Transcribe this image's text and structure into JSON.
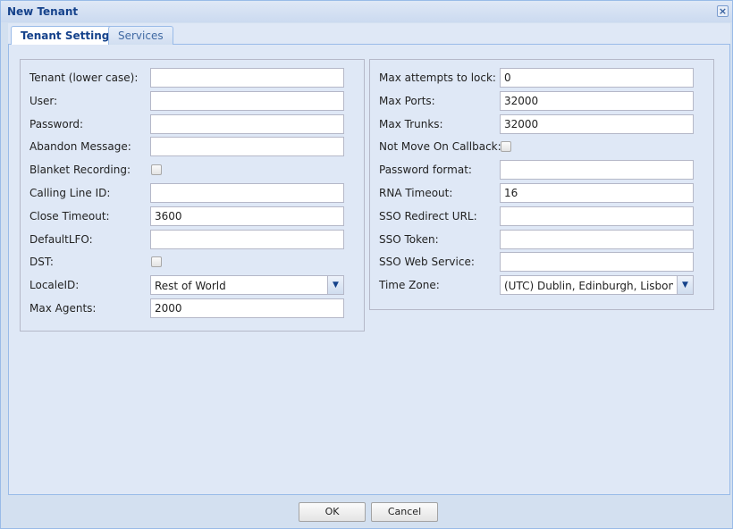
{
  "window": {
    "title": "New Tenant",
    "close_label": "×"
  },
  "tabs": [
    {
      "label": "Tenant Settings",
      "active": true
    },
    {
      "label": "Services",
      "active": false
    }
  ],
  "left_fields": [
    {
      "label": "Tenant (lower case):",
      "type": "text",
      "value": ""
    },
    {
      "label": "User:",
      "type": "text",
      "value": ""
    },
    {
      "label": "Password:",
      "type": "text",
      "value": ""
    },
    {
      "label": "Abandon Message:",
      "type": "text",
      "value": ""
    },
    {
      "label": "Blanket Recording:",
      "type": "checkbox",
      "checked": false
    },
    {
      "label": "Calling Line ID:",
      "type": "text",
      "value": ""
    },
    {
      "label": "Close Timeout:",
      "type": "text",
      "value": "3600"
    },
    {
      "label": "DefaultLFO:",
      "type": "text",
      "value": ""
    },
    {
      "label": "DST:",
      "type": "checkbox",
      "checked": false
    },
    {
      "label": "LocaleID:",
      "type": "combo",
      "value": "Rest of World"
    },
    {
      "label": "Max Agents:",
      "type": "text",
      "value": "2000"
    }
  ],
  "right_fields": [
    {
      "label": "Max attempts to lock:",
      "type": "text",
      "value": "0"
    },
    {
      "label": "Max Ports:",
      "type": "text",
      "value": "32000"
    },
    {
      "label": "Max Trunks:",
      "type": "text",
      "value": "32000"
    },
    {
      "label": "Not Move On Callback:",
      "type": "checkbox",
      "checked": false
    },
    {
      "label": "Password format:",
      "type": "text",
      "value": ""
    },
    {
      "label": "RNA Timeout:",
      "type": "text",
      "value": "16"
    },
    {
      "label": "SSO Redirect URL:",
      "type": "text",
      "value": ""
    },
    {
      "label": "SSO Token:",
      "type": "text",
      "value": ""
    },
    {
      "label": "SSO Web Service:",
      "type": "text",
      "value": ""
    },
    {
      "label": "Time Zone:",
      "type": "combo",
      "value": "(UTC) Dublin, Edinburgh, Lisbon, London"
    }
  ],
  "buttons": {
    "ok_label": "OK",
    "cancel_label": "Cancel"
  }
}
